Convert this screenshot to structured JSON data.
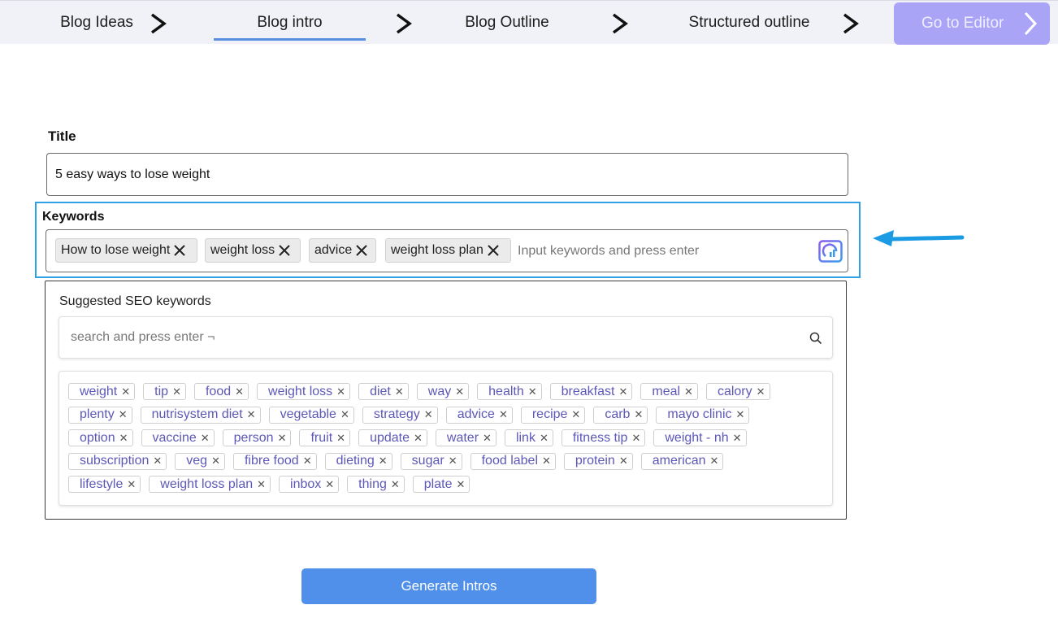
{
  "stepper": {
    "steps": [
      {
        "label": "Blog Ideas"
      },
      {
        "label": "Blog intro"
      },
      {
        "label": "Blog Outline"
      },
      {
        "label": "Structured outline"
      }
    ],
    "active_index": 1,
    "go_editor_label": "Go to Editor"
  },
  "form": {
    "title_label": "Title",
    "title_value": "5 easy ways to lose weight",
    "keywords_label": "Keywords",
    "keywords": [
      "How to lose weight",
      "weight loss",
      "advice",
      "weight loss plan"
    ],
    "keywords_placeholder": "Input keywords and press enter"
  },
  "suggestions": {
    "title": "Suggested SEO keywords",
    "search_placeholder": "search and press enter ¬",
    "rows": [
      [
        "weight",
        "tip",
        "food",
        "weight loss",
        "diet",
        "way",
        "health",
        "breakfast",
        "meal",
        "calory"
      ],
      [
        "plenty",
        "nutrisystem diet",
        "vegetable",
        "strategy",
        "advice",
        "recipe",
        "carb",
        "mayo clinic"
      ],
      [
        "option",
        "vaccine",
        "person",
        "fruit",
        "update",
        "water",
        "link",
        "fitness tip",
        "weight - nh"
      ],
      [
        "subscription",
        "veg",
        "fibre food",
        "dieting",
        "sugar",
        "food label",
        "protein",
        "american"
      ],
      [
        "lifestyle",
        "weight loss plan",
        "inbox",
        "thing",
        "plate"
      ]
    ]
  },
  "generate_label": "Generate Intros",
  "colors": {
    "accent": "#5090ea",
    "go_editor_bg": "#aaa4f7",
    "highlight_border": "#2da1e4",
    "tag_text": "#5d58b8",
    "arrow": "#1b9be3"
  }
}
